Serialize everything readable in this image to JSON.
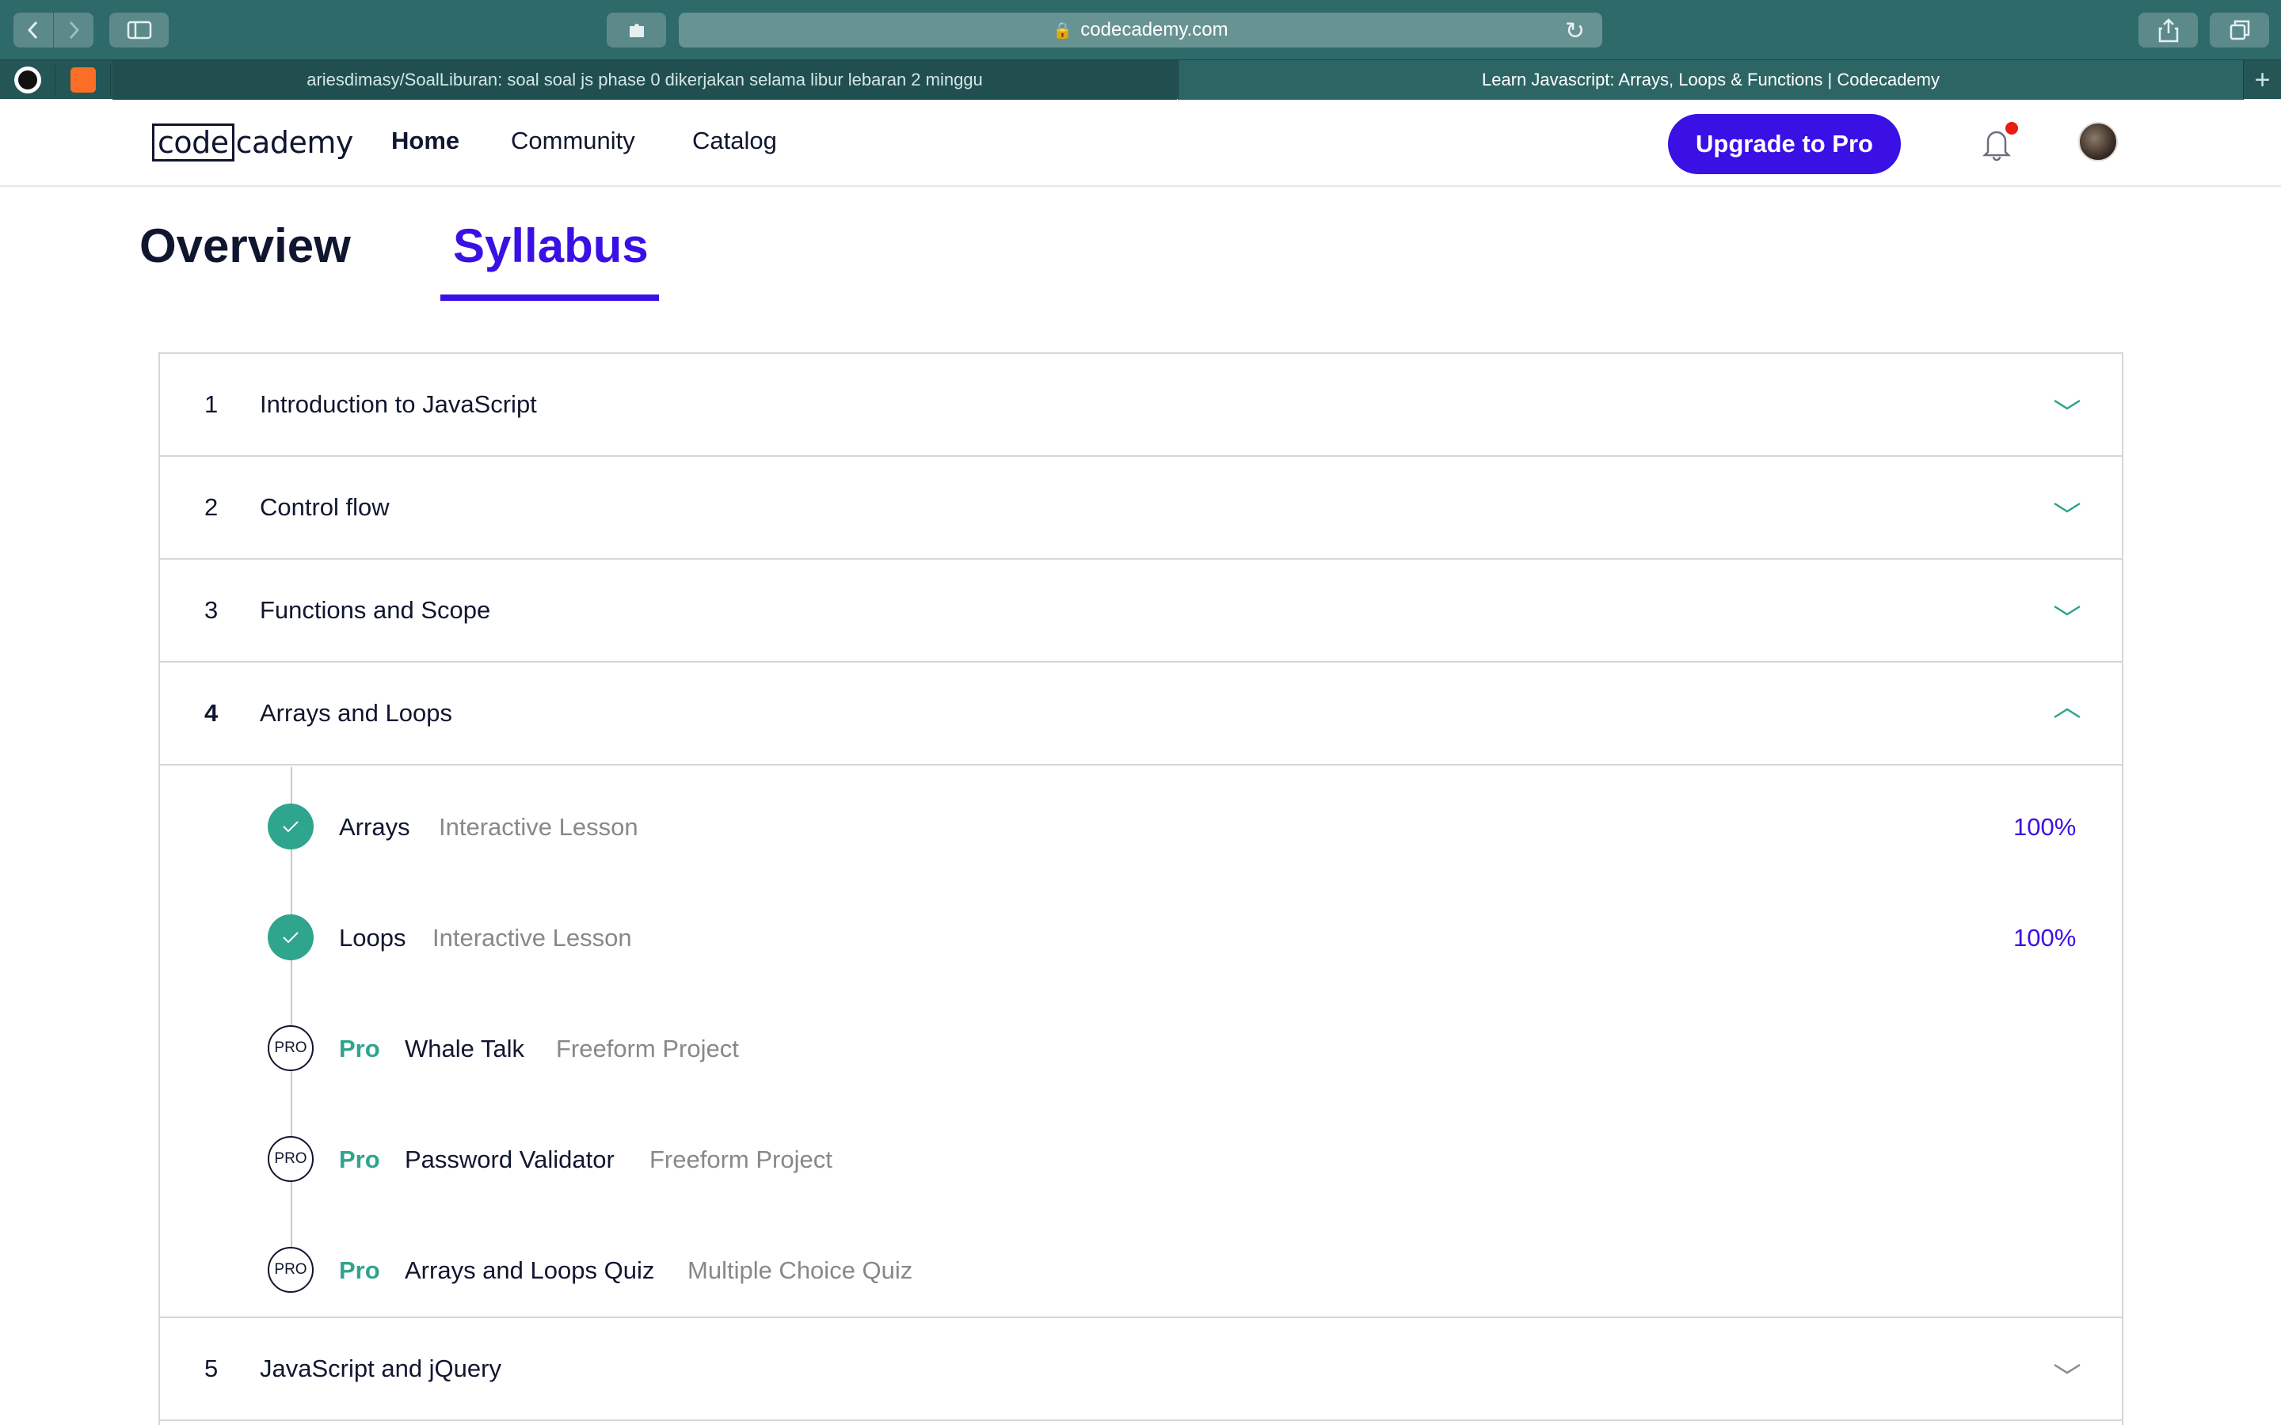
{
  "browser": {
    "url": "codecademy.com",
    "tabs": [
      {
        "label": "ariesdimasy/SoalLiburan: soal soal js phase 0 dikerjakan selama libur lebaran 2 minggu"
      },
      {
        "label": "Learn Javascript: Arrays, Loops & Functions | Codecademy"
      }
    ],
    "new_tab": "+"
  },
  "header": {
    "logo_code": "code",
    "logo_cademy": "cademy",
    "nav": {
      "home": "Home",
      "community": "Community",
      "catalog": "Catalog"
    },
    "upgrade_label": "Upgrade to Pro"
  },
  "page_tabs": {
    "overview": "Overview",
    "syllabus": "Syllabus"
  },
  "syllabus": {
    "modules": [
      {
        "num": "1",
        "title": "Introduction to JavaScript",
        "expanded": false
      },
      {
        "num": "2",
        "title": "Control flow",
        "expanded": false
      },
      {
        "num": "3",
        "title": "Functions and Scope",
        "expanded": false
      },
      {
        "num": "4",
        "title": "Arrays and Loops",
        "expanded": true
      },
      {
        "num": "5",
        "title": "JavaScript and jQuery",
        "expanded": false
      }
    ],
    "lessons": [
      {
        "name": "Arrays",
        "type": "Interactive Lesson",
        "progress": "100%",
        "completed": true
      },
      {
        "name": "Loops",
        "type": "Interactive Lesson",
        "progress": "100%",
        "completed": true
      },
      {
        "pro": "Pro",
        "badge": "PRO",
        "name": "Whale Talk",
        "type": "Freeform Project"
      },
      {
        "pro": "Pro",
        "badge": "PRO",
        "name": "Password Validator",
        "type": "Freeform Project"
      },
      {
        "pro": "Pro",
        "badge": "PRO",
        "name": "Arrays and Loops Quiz",
        "type": "Multiple Choice Quiz"
      }
    ]
  },
  "colors": {
    "accent": "#3a10e5",
    "success": "#2ea58c",
    "text": "#10162f",
    "muted": "#888888"
  }
}
